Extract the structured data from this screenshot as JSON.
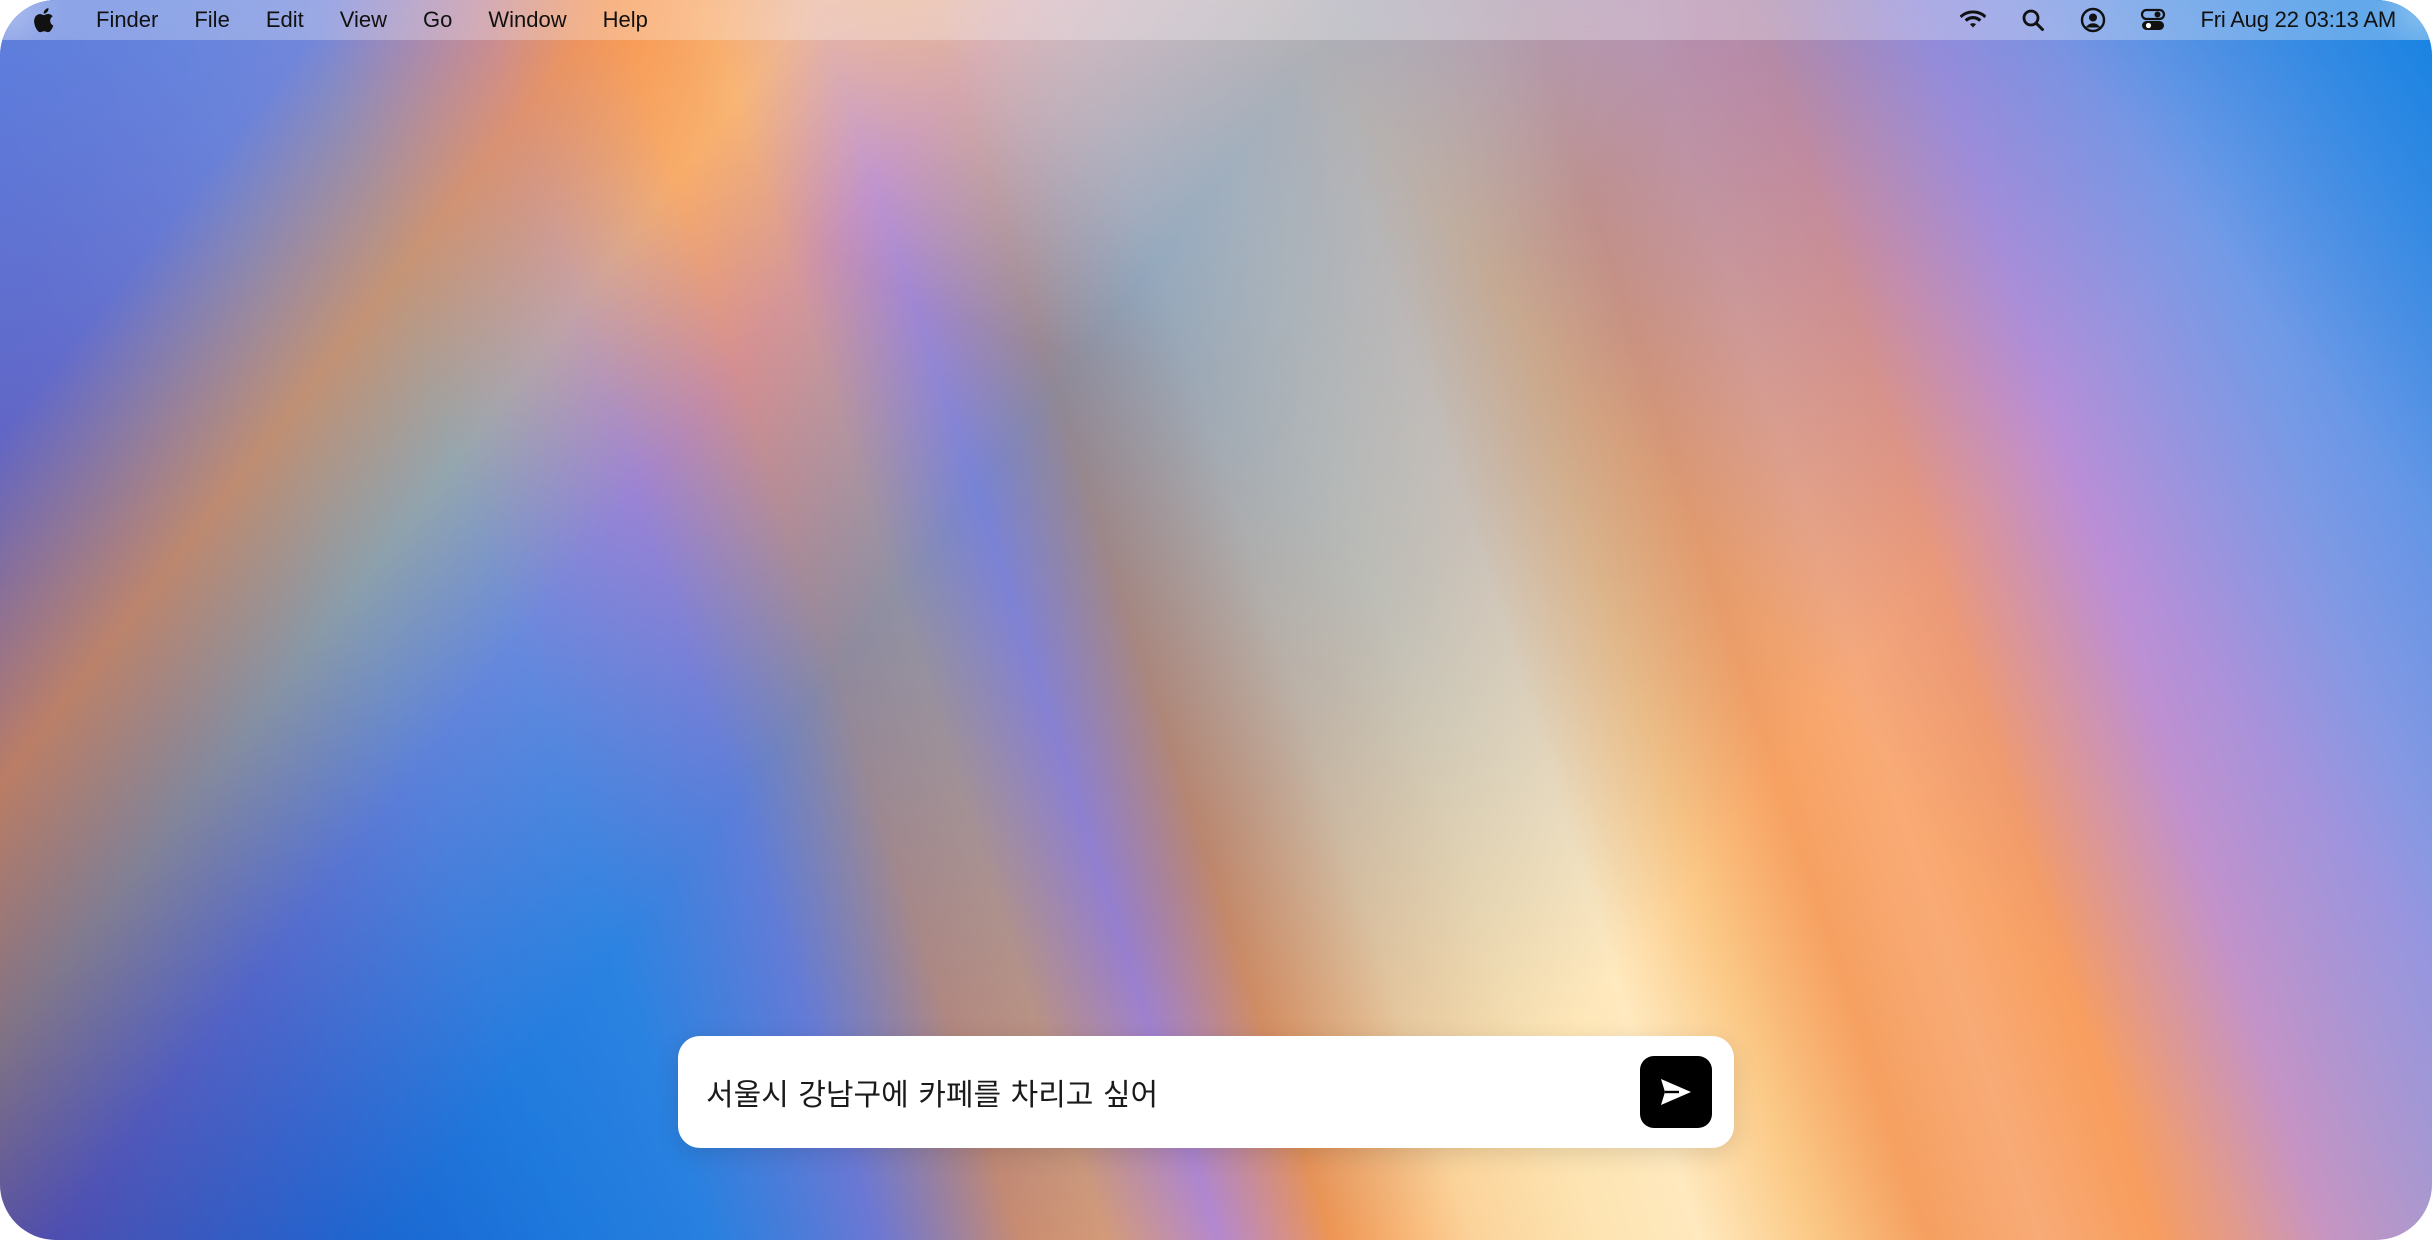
{
  "menubar": {
    "apple_icon": "apple-logo-icon",
    "items": [
      {
        "label": "Finder"
      },
      {
        "label": "File"
      },
      {
        "label": "Edit"
      },
      {
        "label": "View"
      },
      {
        "label": "Go"
      },
      {
        "label": "Window"
      },
      {
        "label": "Help"
      }
    ],
    "status_icons": [
      "wifi-icon",
      "search-icon",
      "user-account-icon",
      "control-center-icon"
    ],
    "clock": "Fri Aug 22 03:13 AM"
  },
  "chat": {
    "input_value": "서울시 강남구에 카페를 차리고 싶어",
    "send_icon": "send-icon",
    "send_button_color": "#000000"
  },
  "colors": {
    "wallpaper_blue": "#0a4fc2",
    "wallpaper_orange": "#f79a5c",
    "wallpaper_cream": "#ffe9be",
    "wallpaper_purple": "#b990d6"
  }
}
